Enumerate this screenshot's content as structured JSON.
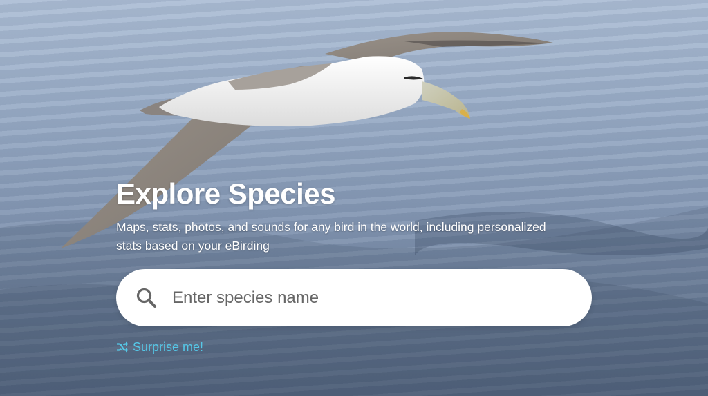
{
  "hero": {
    "title": "Explore Species",
    "subtitle": "Maps, stats, photos, and sounds for any bird in the world, including personalized stats based on your eBirding"
  },
  "search": {
    "placeholder": "Enter species name",
    "icon": "search-icon"
  },
  "surprise": {
    "label": "Surprise me!",
    "icon": "shuffle-icon"
  },
  "colors": {
    "accent": "#55c8e8",
    "title_text": "#ffffff",
    "search_bg": "#ffffff"
  }
}
